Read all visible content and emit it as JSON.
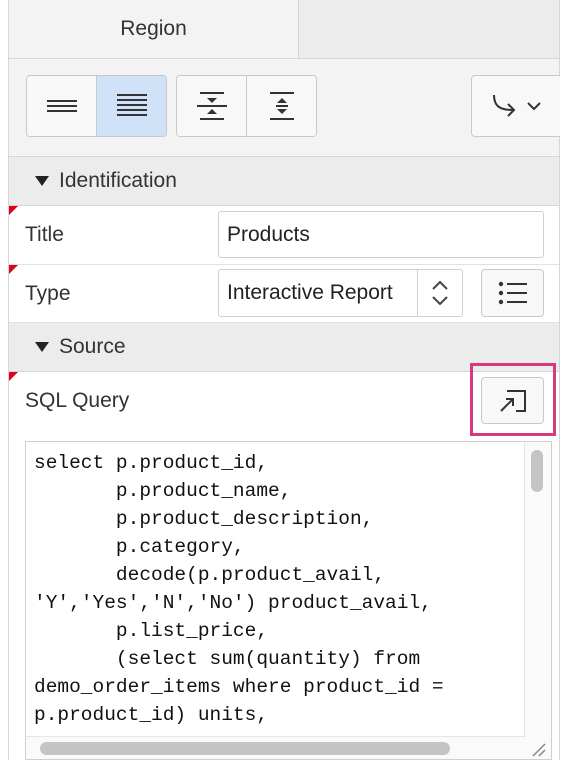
{
  "tabs": {
    "active_label": "Region"
  },
  "toolbar": {
    "layout_buttons": [
      {
        "icon": "lines-sparse-icon",
        "selected": false
      },
      {
        "icon": "lines-dense-icon",
        "selected": true
      }
    ],
    "expand_buttons": [
      {
        "icon": "collapse-all-icon"
      },
      {
        "icon": "expand-all-icon"
      }
    ],
    "go_to_menu_icon": "go-to-group-icon"
  },
  "sections": {
    "identification": "Identification",
    "source": "Source"
  },
  "fields": {
    "title": {
      "label": "Title",
      "value": "Products"
    },
    "type": {
      "label": "Type",
      "value": "Interactive Report"
    },
    "sql": {
      "label": "SQL Query"
    }
  },
  "code": {
    "lines": [
      "select p.product_id,",
      "       p.product_name,",
      "       p.product_description,",
      "       p.category,",
      "       decode(p.product_avail,",
      "'Y','Yes','N','No') product_avail,",
      "       p.list_price,",
      "       (select sum(quantity) from",
      "demo_order_items where product_id =",
      "p.product_id) units,"
    ]
  },
  "colors": {
    "selected_bg": "#cfe2f8",
    "highlight": "#d63a7a",
    "required_marker": "#e0001b"
  }
}
